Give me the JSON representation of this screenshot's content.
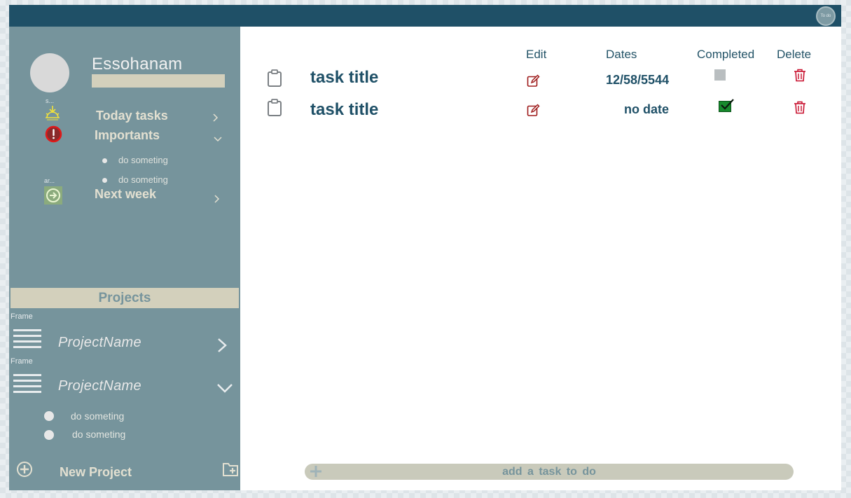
{
  "app": {
    "logo_text": "To do"
  },
  "user": {
    "name": "Essohanam"
  },
  "sidebar": {
    "tiny_label_1": "s...",
    "tiny_label_2": "ar...",
    "nav": [
      {
        "label": "Today tasks",
        "icon": "sunrise-icon",
        "chevron": "right"
      },
      {
        "label": "Importants",
        "icon": "exclamation-circle-icon",
        "chevron": "down",
        "items": [
          "do someting",
          "do someting"
        ]
      },
      {
        "label": "Next week",
        "icon": "arrow-right-circle-icon",
        "chevron": "right"
      }
    ]
  },
  "projects": {
    "header": "Projects",
    "frame_label": "Frame",
    "list": [
      {
        "name": "ProjectName",
        "chevron": "right",
        "items": []
      },
      {
        "name": "ProjectName",
        "chevron": "down",
        "items": [
          "do someting",
          "do someting"
        ]
      }
    ],
    "new_project_label": "New Project"
  },
  "table": {
    "columns": {
      "edit": "Edit",
      "dates": "Dates",
      "completed": "Completed",
      "delete": "Delete"
    },
    "tasks": [
      {
        "title": "task title",
        "date": "12/58/5544",
        "completed": false
      },
      {
        "title": "task title",
        "date": "no date",
        "completed": true
      }
    ]
  },
  "add_task": {
    "label": "add  a task  to do"
  },
  "colors": {
    "topbar": "#1f5067",
    "sidebar": "#76949c",
    "accent_beige": "#d3d0bc",
    "danger": "#c8102e",
    "completed_green": "#178a2d"
  }
}
